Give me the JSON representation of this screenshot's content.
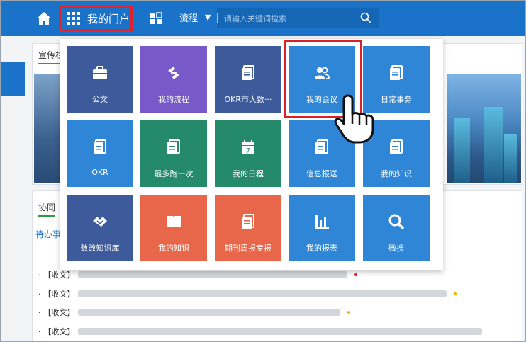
{
  "header": {
    "portal_label": "我的门户",
    "process_label": "流程",
    "search_placeholder": "请输入关键词搜索"
  },
  "tabs": {
    "promo_label": "宣传栏",
    "collab_label": "协同"
  },
  "todo_link": "待办事",
  "doc_list": [
    {
      "tag": "【",
      "type": "收文】",
      "mark": "red"
    },
    {
      "tag": "【",
      "type": "收文】",
      "mark": "yellow"
    },
    {
      "tag": "【",
      "type": "收文】",
      "mark": "yellow"
    },
    {
      "tag": "【",
      "type": "收文】",
      "mark": "none"
    }
  ],
  "menu_tiles": [
    {
      "label": "公文",
      "icon": "briefcase-icon",
      "color": "#3d5a9b"
    },
    {
      "label": "我的流程",
      "icon": "flow-icon",
      "color": "#7759c9"
    },
    {
      "label": "OKR市大数···",
      "icon": "document-icon",
      "color": "#3d5a9b"
    },
    {
      "label": "我的会议",
      "icon": "people-icon",
      "color": "#2f86d6"
    },
    {
      "label": "日常事务",
      "icon": "document-icon",
      "color": "#2f86d6"
    },
    {
      "label": "OKR",
      "icon": "document-icon",
      "color": "#2f86d6"
    },
    {
      "label": "最多跑一次",
      "icon": "document-icon",
      "color": "#258a6a"
    },
    {
      "label": "我的日程",
      "icon": "calendar-icon",
      "color": "#258a6a"
    },
    {
      "label": "信息报送",
      "icon": "document-icon",
      "color": "#2f86d6"
    },
    {
      "label": "我的知识",
      "icon": "document-icon",
      "color": "#2f86d6"
    },
    {
      "label": "数改知识库",
      "icon": "handshake-icon",
      "color": "#3d5a9b"
    },
    {
      "label": "我的知识",
      "icon": "book-icon",
      "color": "#e8674a"
    },
    {
      "label": "期刊周报专报",
      "icon": "document-icon",
      "color": "#e8674a"
    },
    {
      "label": "我的报表",
      "icon": "bar-chart-icon",
      "color": "#2f86d6"
    },
    {
      "label": "微搜",
      "icon": "magnifier-icon",
      "color": "#2f86d6"
    }
  ],
  "calendar_day": "7"
}
